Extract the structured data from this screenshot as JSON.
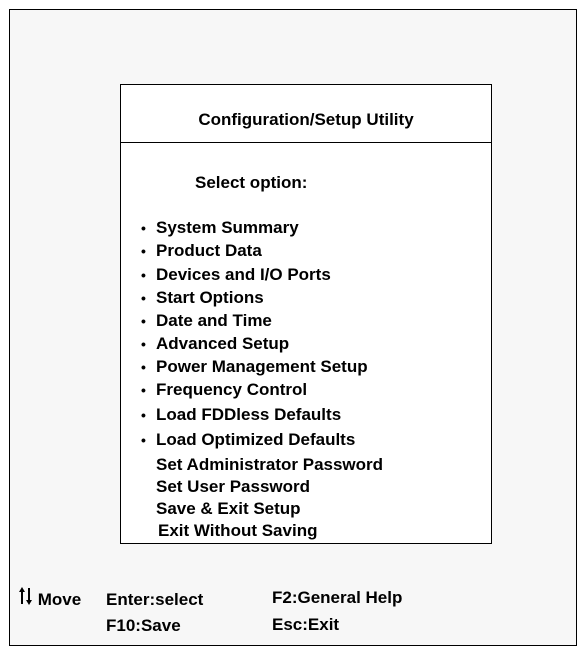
{
  "window": {
    "title": "Configuration/Setup Utility"
  },
  "menu": {
    "prompt": "Select  option:",
    "items": [
      {
        "label": "System Summary",
        "bullet": true
      },
      {
        "label": "Product Data",
        "bullet": true
      },
      {
        "label": "Devices and I/O Ports",
        "bullet": true
      },
      {
        "label": "Start Options",
        "bullet": true
      },
      {
        "label": "Date and Time",
        "bullet": true
      },
      {
        "label": "Advanced Setup",
        "bullet": true
      },
      {
        "label": "Power Management Setup",
        "bullet": true
      },
      {
        "label": "Frequency Control",
        "bullet": true
      },
      {
        "label": "Load FDDless Defaults",
        "bullet": true
      },
      {
        "label": "Load Optimized Defaults",
        "bullet": true
      },
      {
        "label": "Set Administrator  Password",
        "bullet": false
      },
      {
        "label": "Set User Password",
        "bullet": false
      },
      {
        "label": "Save & Exit Setup",
        "bullet": false
      },
      {
        "label": "Exit Without Saving",
        "bullet": false
      }
    ]
  },
  "help": {
    "move_icon": "up-down-arrows-icon",
    "move": "Move",
    "enter": "Enter:select",
    "f2": "F2:General Help",
    "f10": "F10:Save",
    "esc": "Esc:Exit"
  },
  "bullet_glyph": "•"
}
